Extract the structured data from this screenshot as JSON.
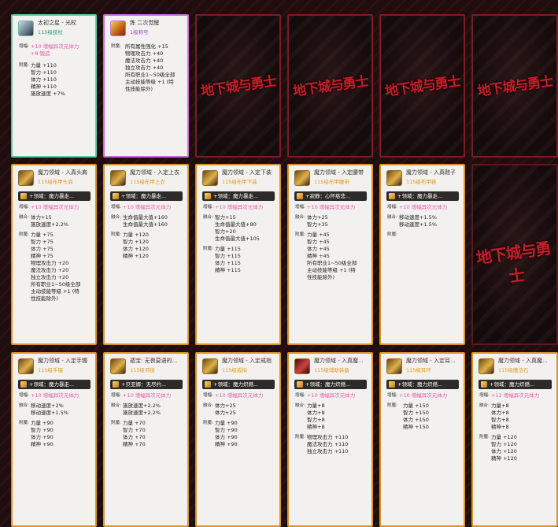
{
  "labels": {
    "enhance": "增幅:",
    "fusion": "融合:",
    "attr": "附魔:"
  },
  "logo": {
    "main": "地下城与勇士",
    "sub": ""
  },
  "row1": [
    {
      "name": "太初之星 - 光杖",
      "sub": "115级技杖",
      "enhance": [
        "+10 增幅异次元体力",
        "+8 锻造"
      ],
      "attr": [
        "力量 +110",
        "智力 +110",
        "体力 +110",
        "精神 +110",
        "施放速度 +7%"
      ]
    },
    {
      "name": "炼 二次觉醒",
      "sub": "1级称号",
      "attr": [
        "所有属性强化 +15",
        "物理攻击力 +40",
        "魔法攻击力 +40",
        "独立攻击力 +40",
        "所有职业1~50级全部",
        "主动技能等级 +1 (特",
        "性技能除外)"
      ]
    }
  ],
  "row2": [
    {
      "name": "魔力领域 - 入真头肩",
      "sub": "115级布甲头肩",
      "emb": "+领域：魔力暴走...",
      "enhance": [
        "+10 增幅异次元体力"
      ],
      "fusion": [
        "体力+15",
        "施放速度+2.2%"
      ],
      "attr": [
        "力量 +75",
        "智力 +75",
        "体力 +75",
        "精神 +75",
        "物理攻击力 +20",
        "魔法攻击力 +20",
        "独立攻击力 +20",
        "所有职业1~50级全部",
        "主动技能等级 +1 (特",
        "性技能除外)"
      ]
    },
    {
      "name": "魔力领域 - 入定上衣",
      "sub": "115级布甲上衣",
      "emb": "+领域：魔力暴走...",
      "enhance": [
        "+10 增幅异次元体力"
      ],
      "fusion": [
        "生命值最大值+160",
        "生命值最大值+160"
      ],
      "attr": [
        "力量 +120",
        "智力 +120",
        "体力 +120",
        "精神 +120"
      ]
    },
    {
      "name": "魔力领域 - 入定下装",
      "sub": "115级布甲下装",
      "emb": "+领域：魔力暴走...",
      "enhance": [
        "+10 增幅异次元体力"
      ],
      "fusion": [
        "智力+15",
        "生命值最大值+80",
        "智力+20",
        "生命值最大值+105"
      ],
      "attr": [
        "力量 +115",
        "智力 +115",
        "体力 +115",
        "精神 +115"
      ]
    },
    {
      "name": "魔力领域 - 入定腰带",
      "sub": "115级布甲腰带",
      "emb": "+寂静：心怀慈悲...",
      "enhance": [
        "+10 增幅异次元体力"
      ],
      "fusion": [
        "体力+25",
        "智力+35"
      ],
      "attr": [
        "力量 +45",
        "智力 +45",
        "体力 +45",
        "精神 +45",
        "所有职业1~50级全部",
        "主动技能等级 +1 (特",
        "性技能除外)"
      ]
    },
    {
      "name": "魔力领域 - 入真鞋子",
      "sub": "115级布甲鞋",
      "emb": "+领域：魔力暴走...",
      "enhance": [
        "+10 增幅异次元体力"
      ],
      "fusion": [
        "移动速度+1.5%",
        "移动速度+1.5%"
      ],
      "attr": []
    }
  ],
  "row3": [
    {
      "name": "魔力领域 - 入定手镯",
      "sub": "115级手镯",
      "emb": "+领域：魔力暴走...",
      "enhance": [
        "+10 增幅异次元体力"
      ],
      "fusion": [
        "移动速度+2%",
        "移动速度+1.5%"
      ],
      "attr": [
        "力量 +90",
        "智力 +90",
        "体力 +90",
        "精神 +90"
      ]
    },
    {
      "name": "遁宝: 无畏莫语的...",
      "sub": "115级项链",
      "emb": "+贝亚娜：无尽约...",
      "enhance": [
        "+10 增幅异次元体力"
      ],
      "fusion": [
        "施放速度+2.2%",
        "施放速度+2.2%"
      ],
      "attr": [
        "力量 +70",
        "智力 +70",
        "体力 +70",
        "精神 +70"
      ]
    },
    {
      "name": "魔力领域 - 入定戒指",
      "sub": "115级戒指",
      "emb": "+领域：魔力炽燃...",
      "enhance": [
        "+10 增幅异次元体力"
      ],
      "fusion": [
        "体力+25",
        "体力+25"
      ],
      "attr": [
        "力量 +90",
        "智力 +90",
        "体力 +90",
        "精神 +90"
      ]
    },
    {
      "name": "魔力领域 - 入真魔...",
      "sub": "115级辅助装备",
      "emb": "+领域：魔力炽燃...",
      "enhance": [
        "+10 增幅异次元体力"
      ],
      "fusion": [
        "力量+8",
        "体力+8",
        "智力+8",
        "精神+8"
      ],
      "attr": [
        "物理攻击力 +110",
        "魔法攻击力 +110",
        "独立攻击力 +110"
      ]
    },
    {
      "name": "魔力领域 - 入定耳...",
      "sub": "115级耳环",
      "emb": "+领域：魔力炽燃...",
      "enhance": [
        "+10 增幅异次元体力"
      ],
      "fusion": [],
      "attr": [
        "力量 +150",
        "智力 +150",
        "体力 +150",
        "精神 +150"
      ]
    },
    {
      "name": "魔力领域 - 入真魔...",
      "sub": "115级魔法石",
      "emb": "+领域：魔力炽燃...",
      "enhance": [
        "+12 增幅异次元体力"
      ],
      "fusion": [
        "力量+8",
        "体力+8",
        "智力+8",
        "精神+8"
      ],
      "attr": [
        "力量 +120",
        "智力 +120",
        "体力 +120",
        "精神 +120"
      ]
    }
  ]
}
